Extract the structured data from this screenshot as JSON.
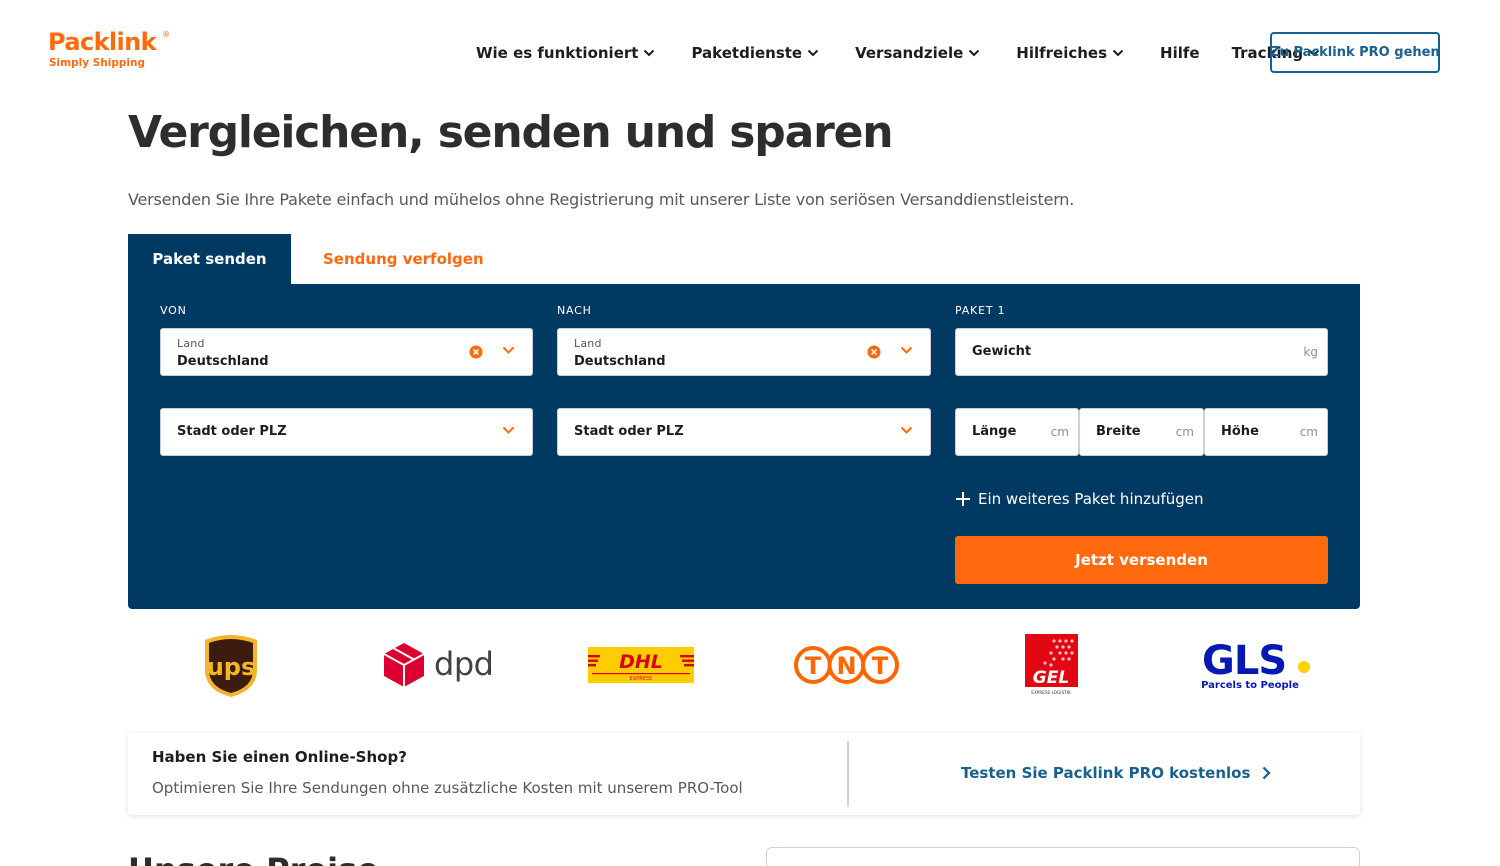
{
  "header": {
    "logo_name": "Packlink",
    "logo_reg": "®",
    "logo_tagline": "Simply Shipping",
    "nav": [
      {
        "label": "Wie es funktioniert",
        "has_dropdown": true
      },
      {
        "label": "Paketdienste",
        "has_dropdown": true
      },
      {
        "label": "Versandziele",
        "has_dropdown": true
      },
      {
        "label": "Hilfreiches",
        "has_dropdown": true
      },
      {
        "label": "Hilfe",
        "has_dropdown": false
      },
      {
        "label": "Tracking",
        "has_dropdown": true
      }
    ],
    "pro_button": "Zu Packlink PRO gehen"
  },
  "hero": {
    "title": "Vergleichen, senden und sparen",
    "subtitle": "Versenden Sie Ihre Pakete einfach und mühelos ohne Registrierung mit unserer Liste von seriösen Versanddienstleistern."
  },
  "tabs": [
    {
      "label": "Paket senden",
      "active": true
    },
    {
      "label": "Sendung verfolgen",
      "active": false
    }
  ],
  "form": {
    "from": {
      "heading": "VON",
      "country_label": "Land",
      "country_value": "Deutschland",
      "city_placeholder": "Stadt oder PLZ"
    },
    "to": {
      "heading": "NACH",
      "country_label": "Land",
      "country_value": "Deutschland",
      "city_placeholder": "Stadt oder PLZ"
    },
    "package": {
      "heading": "PAKET 1",
      "weight_label": "Gewicht",
      "weight_unit": "kg",
      "length_label": "Länge",
      "width_label": "Breite",
      "height_label": "Höhe",
      "dim_unit": "cm"
    },
    "add_package": "Ein weiteres Paket hinzufügen",
    "submit": "Jetzt versenden"
  },
  "carriers": {
    "ups": "ups",
    "dpd": "dpd",
    "dhl": "DHL",
    "dhl_sub": "EXPRESS",
    "tnt": [
      "T",
      "N",
      "T"
    ],
    "gel": "GEL",
    "gel_sub": "EXPRESS LOGISTIK",
    "gls": "GLS",
    "gls_sub": "Parcels to People"
  },
  "promo": {
    "title": "Haben Sie einen Online-Shop?",
    "text": "Optimieren Sie Ihre Sendungen ohne zusätzliche Kosten mit unserem PRO-Tool",
    "link": "Testen Sie Packlink PRO kostenlos"
  },
  "colors": {
    "brand_orange": "#ff6a0e",
    "panel_navy": "#003a63",
    "link_blue": "#17608f"
  },
  "partial": {
    "heading": "Unsere Preise"
  }
}
